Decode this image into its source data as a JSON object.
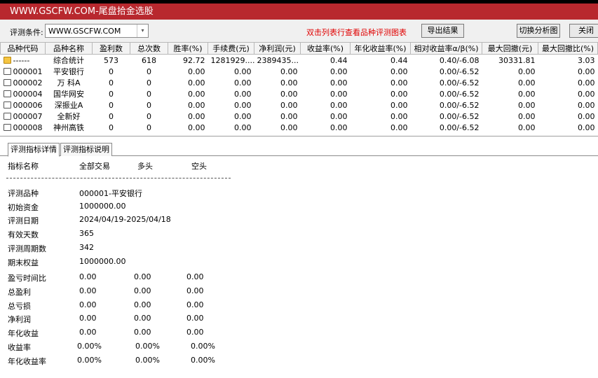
{
  "window": {
    "title": "WWW.GSCFW.COM-尾盘拾金选股"
  },
  "toolbar": {
    "condition_label": "评测条件:",
    "condition_value": "WWW.GSCFW.COM",
    "hint": "双击列表行查看品种评测图表",
    "export_label": "导出结果",
    "switch_chart_label": "切换分析图",
    "close_label": "关闭"
  },
  "table": {
    "headers": [
      "品种代码",
      "品种名称",
      "盈利数",
      "总次数",
      "胜率(%)",
      "手续费(元)",
      "净利润(元)",
      "收益率(%)",
      "年化收益率(%)",
      "相对收益率α/β(%)",
      "最大回撤(元)",
      "最大回撤比(%)"
    ],
    "rows": [
      [
        "------",
        "综合统计",
        "573",
        "618",
        "92.72",
        "1281929....",
        "2389435...",
        "0.44",
        "0.44",
        "0.40/-6.08",
        "30331.81",
        "3.03"
      ],
      [
        "000001",
        "平安银行",
        "0",
        "0",
        "0.00",
        "0.00",
        "0.00",
        "0.00",
        "0.00",
        "0.00/-6.52",
        "0.00",
        "0.00"
      ],
      [
        "000002",
        "万 科A",
        "0",
        "0",
        "0.00",
        "0.00",
        "0.00",
        "0.00",
        "0.00",
        "0.00/-6.52",
        "0.00",
        "0.00"
      ],
      [
        "000004",
        "国华网安",
        "0",
        "0",
        "0.00",
        "0.00",
        "0.00",
        "0.00",
        "0.00",
        "0.00/-6.52",
        "0.00",
        "0.00"
      ],
      [
        "000006",
        "深振业A",
        "0",
        "0",
        "0.00",
        "0.00",
        "0.00",
        "0.00",
        "0.00",
        "0.00/-6.52",
        "0.00",
        "0.00"
      ],
      [
        "000007",
        "全新好",
        "0",
        "0",
        "0.00",
        "0.00",
        "0.00",
        "0.00",
        "0.00",
        "0.00/-6.52",
        "0.00",
        "0.00"
      ],
      [
        "000008",
        "神州高铁",
        "0",
        "0",
        "0.00",
        "0.00",
        "0.00",
        "0.00",
        "0.00",
        "0.00/-6.52",
        "0.00",
        "0.00"
      ]
    ]
  },
  "tabs": [
    "评测指标详情",
    "评测指标说明"
  ],
  "detail": {
    "headers": [
      "指标名称",
      "全部交易",
      "多头",
      "空头"
    ],
    "info": [
      [
        "评测品种",
        "000001-平安银行"
      ],
      [
        "初始资金",
        "1000000.00"
      ],
      [
        "评测日期",
        "2024/04/19-2025/04/18"
      ],
      [
        "有效天数",
        "365"
      ],
      [
        "评测周期数",
        "342"
      ],
      [
        "期末权益",
        "1000000.00"
      ]
    ],
    "metrics": [
      [
        "盈亏时间比",
        "0.00",
        "0.00",
        "0.00"
      ],
      [
        "总盈利",
        "0.00",
        "0.00",
        "0.00"
      ],
      [
        "总亏损",
        "0.00",
        "0.00",
        "0.00"
      ],
      [
        "净利润",
        "0.00",
        "0.00",
        "0.00"
      ],
      [
        "年化收益",
        "0.00",
        "0.00",
        "0.00"
      ],
      [
        "收益率",
        "0.00%",
        "0.00%",
        "0.00%"
      ],
      [
        "年化收益率",
        "0.00%",
        "0.00%",
        "0.00%"
      ]
    ]
  }
}
